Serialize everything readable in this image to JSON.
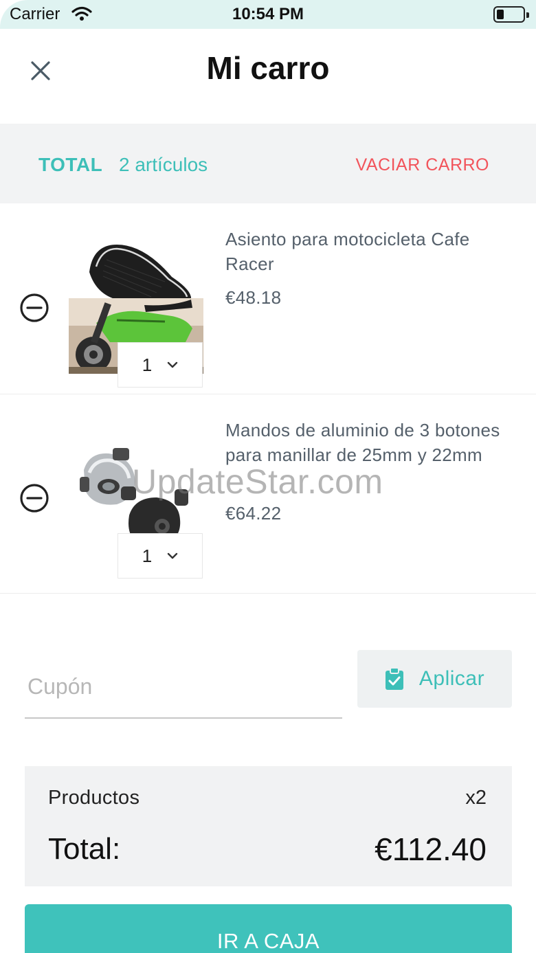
{
  "status_bar": {
    "carrier": "Carrier",
    "time": "10:54 PM",
    "icons": [
      "wifi-icon",
      "battery-icon"
    ]
  },
  "header": {
    "title": "Mi carro",
    "close_icon": "close-icon"
  },
  "total_bar": {
    "label": "TOTAL",
    "count": "2 artículos",
    "empty_action": "VACIAR CARRO"
  },
  "items": [
    {
      "name": "Asiento para motocicleta Cafe Racer",
      "price": "€48.18",
      "quantity": "1",
      "remove_icon": "minus-circle-icon"
    },
    {
      "name": "Mandos de aluminio de 3 botones para manillar de 25mm y 22mm",
      "price": "€64.22",
      "quantity": "1",
      "remove_icon": "minus-circle-icon"
    }
  ],
  "watermark": "UpdateStar.com",
  "coupon": {
    "placeholder": "Cupón",
    "value": "",
    "apply_label": "Aplicar",
    "apply_icon": "clipboard-check-icon"
  },
  "summary": {
    "products_label": "Productos",
    "products_count": "x2",
    "total_label": "Total:",
    "total_value": "€112.40"
  },
  "checkout": {
    "label": "IR A CAJA"
  },
  "colors": {
    "accent": "#3dbfb8",
    "danger": "#f2545b",
    "panel": "#f2f3f4",
    "status_bar": "#dff3f1"
  }
}
